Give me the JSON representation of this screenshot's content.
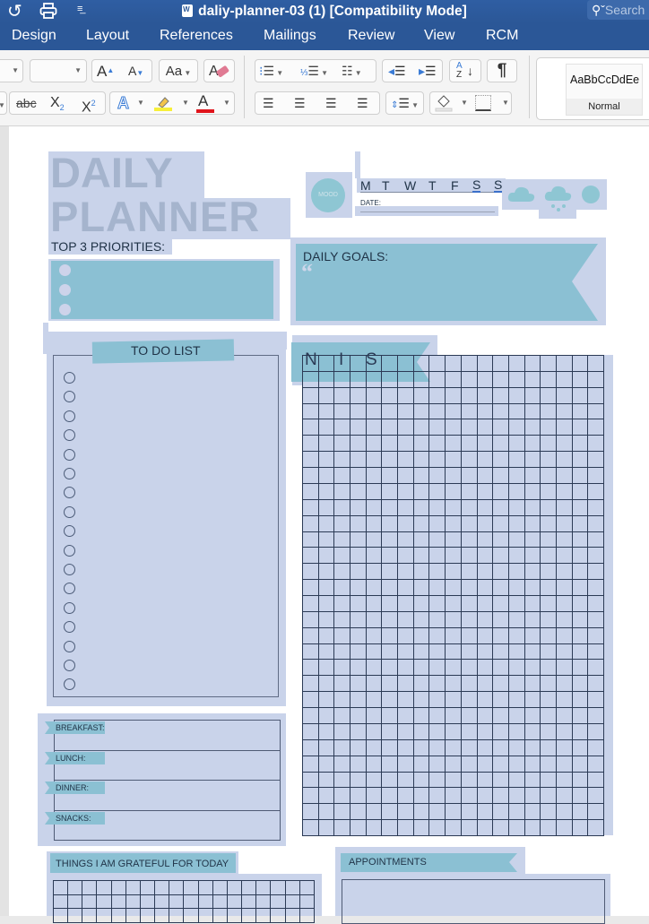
{
  "titlebar": {
    "title": "daliy-planner-03 (1) [Compatibility Mode]",
    "search_placeholder": "Search",
    "icons": [
      "undo-icon",
      "print-icon",
      "customize-toolbar-icon",
      "word-doc-icon",
      "search-icon"
    ]
  },
  "tabs": [
    {
      "label": "Design"
    },
    {
      "label": "Layout"
    },
    {
      "label": "References"
    },
    {
      "label": "Mailings"
    },
    {
      "label": "Review"
    },
    {
      "label": "View"
    },
    {
      "label": "RCM"
    }
  ],
  "ribbon": {
    "font_name_value": "",
    "font_size_value": "",
    "grow_font": "A",
    "shrink_font": "A",
    "change_case": "Aa",
    "strikethrough": "abc",
    "subscript": "X",
    "subscript_mark": "2",
    "superscript": "X",
    "superscript_mark": "2",
    "text_effects": "A",
    "font_color": "A",
    "highlight_color": "#f7ef3a",
    "font_color_bar": "#e0141b",
    "sort_label_a": "A",
    "sort_label_z": "Z",
    "pilcrow": "¶",
    "style_preview": "AaBbCcDdEe",
    "style_name": "Normal"
  },
  "planner": {
    "title_line1": "DAILY",
    "title_line2": "PLANNER",
    "priorities_label": "TOP 3 PRIORITIES:",
    "priorities_count": 3,
    "mood_label": "MOOD",
    "weekdays": [
      "M",
      "T",
      "W",
      "T",
      "F",
      "S",
      "S"
    ],
    "date_label": "DATE:",
    "weather_icons": [
      "cloud-icon",
      "rain-cloud-icon",
      "sun-icon"
    ],
    "goals_label": "DAILY  GOALS:",
    "goals_quote": "“",
    "todo_label": "TO DO LIST",
    "todo_count": 17,
    "notes_label_letters": [
      "N",
      "I",
      "S"
    ],
    "meals": [
      {
        "label": "BREAKFAST:"
      },
      {
        "label": "LUNCH:"
      },
      {
        "label": "DINNER:"
      },
      {
        "label": "SNACKS:"
      }
    ],
    "grateful_label": "THINGS I AM GRATEFUL FOR TODAY",
    "appointments_label": "APPOINTMENTS"
  },
  "colors": {
    "title_bar": "#2b5797",
    "selection": "#c9d3ea",
    "teal": "#8bc0d3",
    "title_text": "#a5b4cd"
  }
}
